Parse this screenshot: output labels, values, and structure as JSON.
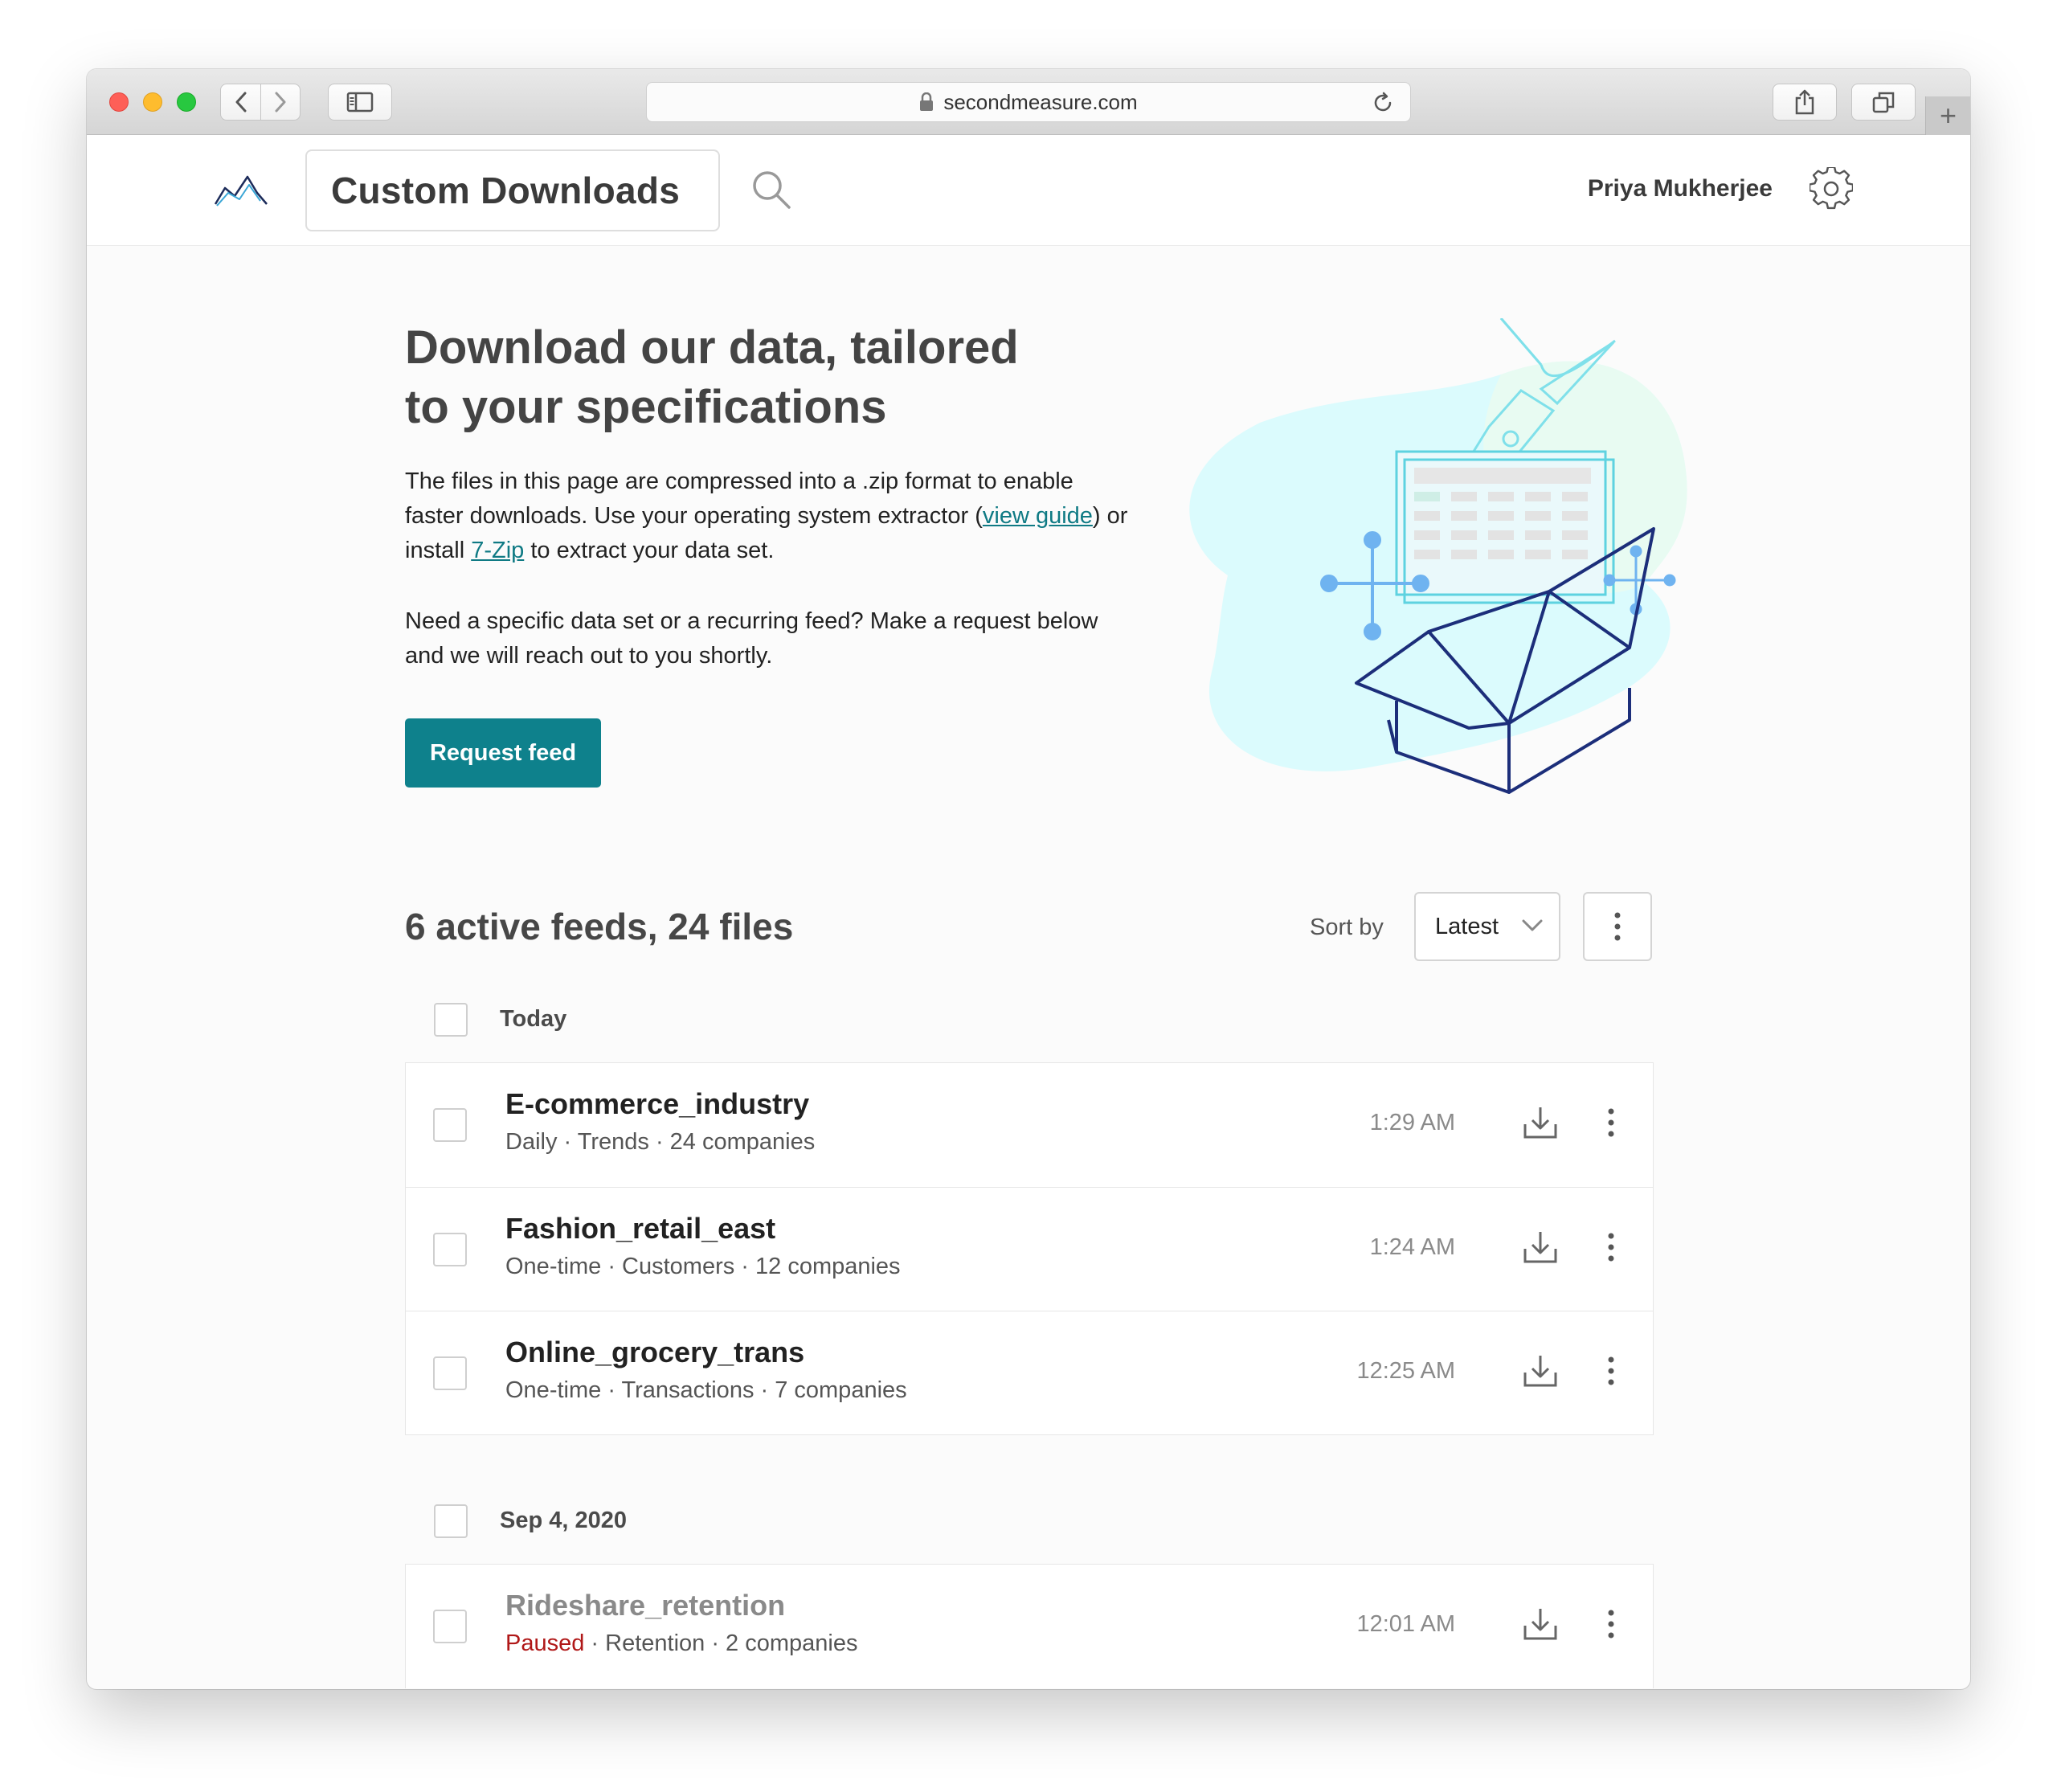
{
  "browser": {
    "url": "secondmeasure.com"
  },
  "header": {
    "title": "Custom Downloads",
    "user_name": "Priya Mukherjee"
  },
  "hero": {
    "title_line1": "Download our data, tailored",
    "title_line2": "to your specifications",
    "p1_part1": "The files in this page are compressed into a .zip format to enable faster downloads. Use your operating system extractor (",
    "p1_link1": "view guide",
    "p1_part2": ") or install ",
    "p1_link2": "7-Zip",
    "p1_part3": " to extract your data set.",
    "p2": "Need a specific data set or a recurring feed? Make a request below and we will reach out to you shortly.",
    "request_button": "Request feed"
  },
  "feeds": {
    "summary": "6 active feeds, 24 files",
    "sort_label": "Sort by",
    "sort_value": "Latest",
    "groups": [
      {
        "label": "Today",
        "items": [
          {
            "name": "E-commerce_industry",
            "meta": "Daily · Trends · 24 companies",
            "time": "1:29 AM"
          },
          {
            "name": "Fashion_retail_east",
            "meta": "One-time · Customers · 12 companies",
            "time": "1:24 AM"
          },
          {
            "name": "Online_grocery_trans",
            "meta": "One-time · Transactions · 7 companies",
            "time": "12:25 AM"
          }
        ]
      },
      {
        "label": "Sep 4, 2020",
        "items": [
          {
            "name": "Rideshare_retention",
            "status": "Paused",
            "meta": " · Retention · 2 companies",
            "time": "12:01 AM"
          }
        ]
      }
    ]
  },
  "colors": {
    "accent": "#0e818c",
    "link": "#0f7a84",
    "paused": "#b01818"
  },
  "icons": [
    "back-icon",
    "forward-icon",
    "sidebar-icon",
    "lock-icon",
    "reload-icon",
    "share-icon",
    "tabs-icon",
    "plus-icon",
    "logo-icon",
    "search-icon",
    "gear-icon",
    "chevron-down-icon",
    "more-vertical-icon",
    "download-icon"
  ]
}
